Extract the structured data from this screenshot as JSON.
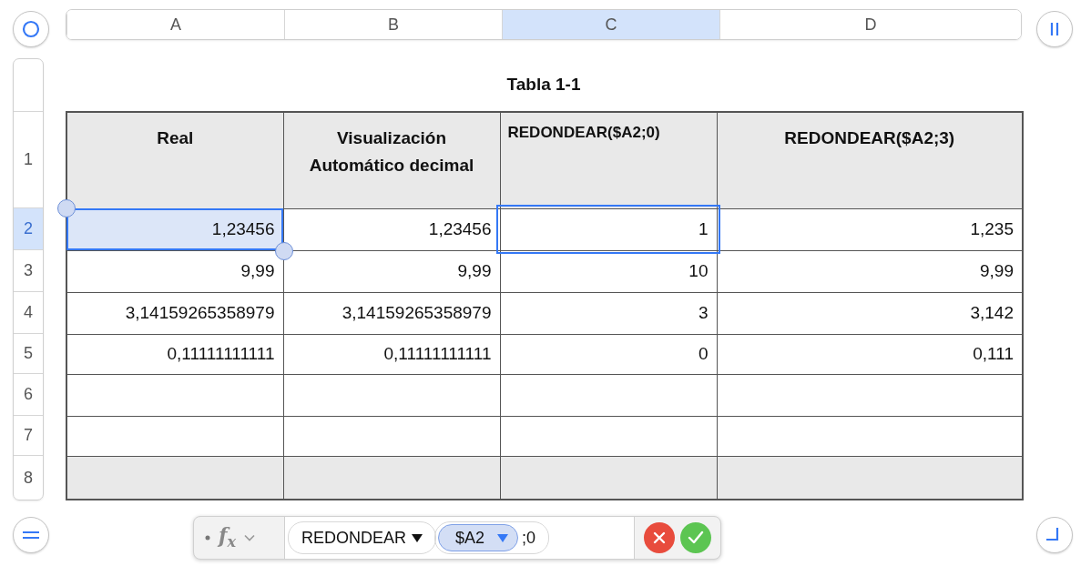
{
  "columns": [
    {
      "label": "A",
      "selected": false
    },
    {
      "label": "B",
      "selected": false
    },
    {
      "label": "C",
      "selected": true
    },
    {
      "label": "D",
      "selected": false
    }
  ],
  "row_headers": [
    {
      "label": "1",
      "selected": false
    },
    {
      "label": "2",
      "selected": true
    },
    {
      "label": "3",
      "selected": false
    },
    {
      "label": "4",
      "selected": false
    },
    {
      "label": "5",
      "selected": false
    },
    {
      "label": "6",
      "selected": false
    },
    {
      "label": "7",
      "selected": false
    },
    {
      "label": "8",
      "selected": false
    }
  ],
  "table": {
    "title": "Tabla 1-1",
    "rows": [
      {
        "kind": "header",
        "cells": [
          {
            "text": "Real"
          },
          {
            "text": "Visualización Automático decimal"
          },
          {
            "text": "REDONDEAR($A2;0)"
          },
          {
            "text": "REDONDEAR($A2;3)"
          }
        ]
      },
      {
        "kind": "body",
        "cells": [
          {
            "text": "1,23456",
            "selected": true,
            "referenced": false
          },
          {
            "text": "1,23456",
            "selected": false,
            "referenced": false
          },
          {
            "text": "1",
            "selected": false,
            "referenced": true
          },
          {
            "text": "1,235",
            "selected": false,
            "referenced": false
          }
        ]
      },
      {
        "kind": "body",
        "cells": [
          {
            "text": "9,99",
            "selected": false,
            "referenced": false
          },
          {
            "text": "9,99",
            "selected": false,
            "referenced": false
          },
          {
            "text": "10",
            "selected": false,
            "referenced": false
          },
          {
            "text": "9,99",
            "selected": false,
            "referenced": false
          }
        ]
      },
      {
        "kind": "body",
        "cells": [
          {
            "text": "3,14159265358979",
            "selected": false,
            "referenced": false
          },
          {
            "text": "3,14159265358979",
            "selected": false,
            "referenced": false
          },
          {
            "text": "3",
            "selected": false,
            "referenced": false
          },
          {
            "text": "3,142",
            "selected": false,
            "referenced": false
          }
        ]
      },
      {
        "kind": "body",
        "cells": [
          {
            "text": "0,11111111111",
            "selected": false,
            "referenced": false
          },
          {
            "text": "0,11111111111",
            "selected": false,
            "referenced": false
          },
          {
            "text": "0",
            "selected": false,
            "referenced": false
          },
          {
            "text": "0,111",
            "selected": false,
            "referenced": false
          }
        ]
      },
      {
        "kind": "body"
      },
      {
        "kind": "body"
      },
      {
        "kind": "footer"
      }
    ]
  },
  "formula_bar": {
    "fx_label": "f$_{x}$",
    "function": "REDONDEAR",
    "reference": "$A2",
    "rest": ";0"
  }
}
